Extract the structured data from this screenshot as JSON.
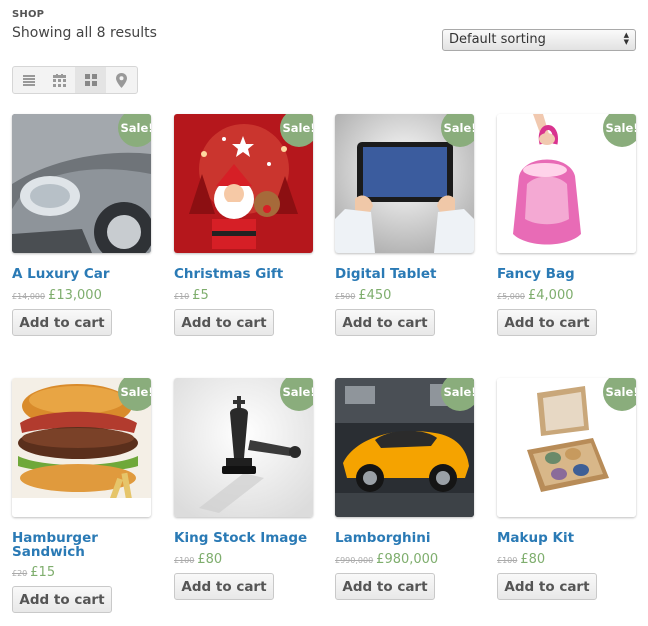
{
  "header": {
    "shop_label": "SHOP",
    "result_count": "Showing all 8 results"
  },
  "sorting": {
    "selected": "Default sorting"
  },
  "view_toggle": [
    "list-view-icon",
    "calendar-view-icon",
    "grid-view-icon",
    "map-view-icon"
  ],
  "colors": {
    "sale_badge": "#8aad7c",
    "title": "#2a7ab5",
    "price": "#7fae6e"
  },
  "products": [
    {
      "name": "A Luxury Car",
      "old_price": "£14,000",
      "price": "£13,000",
      "badge": "Sale!",
      "button": "Add to cart"
    },
    {
      "name": "Christmas Gift",
      "old_price": "£10",
      "price": "£5",
      "badge": "Sale!",
      "button": "Add to cart"
    },
    {
      "name": "Digital Tablet",
      "old_price": "£500",
      "price": "£450",
      "badge": "Sale!",
      "button": "Add to cart"
    },
    {
      "name": "Fancy Bag",
      "old_price": "£5,000",
      "price": "£4,000",
      "badge": "Sale!",
      "button": "Add to cart"
    },
    {
      "name": "Hamburger Sandwich",
      "old_price": "£20",
      "price": "£15",
      "badge": "Sale!",
      "button": "Add to cart"
    },
    {
      "name": "King Stock Image",
      "old_price": "£100",
      "price": "£80",
      "badge": "Sale!",
      "button": "Add to cart"
    },
    {
      "name": "Lamborghini",
      "old_price": "£990,000",
      "price": "£980,000",
      "badge": "Sale!",
      "button": "Add to cart"
    },
    {
      "name": "Makup Kit",
      "old_price": "£100",
      "price": "£80",
      "badge": "Sale!",
      "button": "Add to cart"
    }
  ]
}
